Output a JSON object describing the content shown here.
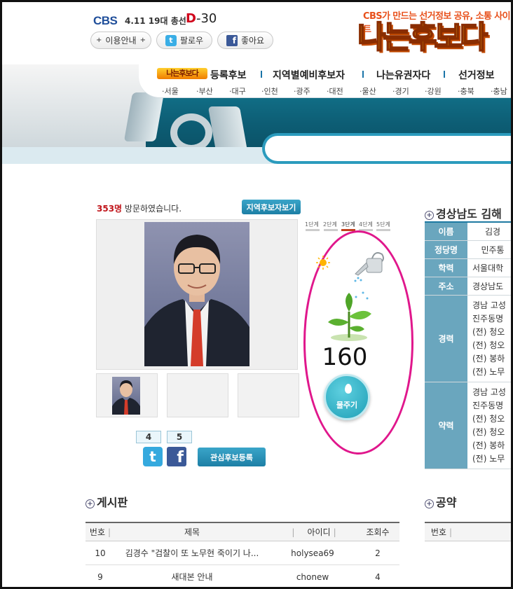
{
  "header": {
    "brand": "CBS",
    "election": "4.11 19대 총선",
    "dday_prefix": "D",
    "dday_value": "-30",
    "slogan": "CBS가 만드는 선거정보 공유, 소통 사이트",
    "logo_text": "나는후보다",
    "buttons": {
      "guide": "이용안내",
      "follow": "팔로우",
      "like": "좋아요"
    }
  },
  "nav": {
    "logo_small": "나는후보다",
    "main": [
      "등록후보",
      "지역별예비후보자",
      "나는유권자다",
      "선거정보"
    ],
    "regions": [
      "서울",
      "부산",
      "대구",
      "인천",
      "광주",
      "대전",
      "울산",
      "경기",
      "강원",
      "충북",
      "충남"
    ]
  },
  "candidate": {
    "visitor_count": "353명",
    "visitor_text": " 방문하였습니다.",
    "region_button": "지역후보자보기",
    "twitter_count": "4",
    "facebook_count": "5",
    "watch_button": "관심후보등록",
    "growth_steps": [
      "1단계",
      "2단계",
      "3단계",
      "4단계",
      "5단계"
    ],
    "active_step": 3,
    "water_count": "160",
    "water_button": "물주기"
  },
  "profile": {
    "title": "경상남도 김해",
    "name_label": "이름",
    "name_value": "김경",
    "party_label": "정당명",
    "party_value": "민주통",
    "edu_label": "학력",
    "edu_value": "서울대학",
    "addr_label": "주소",
    "addr_value": "경상남도",
    "career_label": "경력",
    "career_lines": [
      "경남 고성",
      "진주동명",
      "(전) 청오",
      "(전) 청오",
      "(전) 봉하",
      "(전) 노무"
    ],
    "history_label": "약력",
    "history_lines": [
      "경남 고성",
      "진주동명",
      "(전) 청오",
      "(전) 청오",
      "(전) 봉하",
      "(전) 노무"
    ]
  },
  "board": {
    "title": "게시판",
    "headers": {
      "no": "번호",
      "subject": "제목",
      "id": "아이디",
      "views": "조회수"
    },
    "rows": [
      {
        "no": "10",
        "subject": "김경수 \"검찰이 또 노무현 죽이기 나...",
        "id": "holysea69",
        "views": "2"
      },
      {
        "no": "9",
        "subject": "새대본 안내",
        "id": "chonew",
        "views": "4"
      }
    ]
  },
  "pledge": {
    "title": "공약",
    "header_no": "번호"
  }
}
